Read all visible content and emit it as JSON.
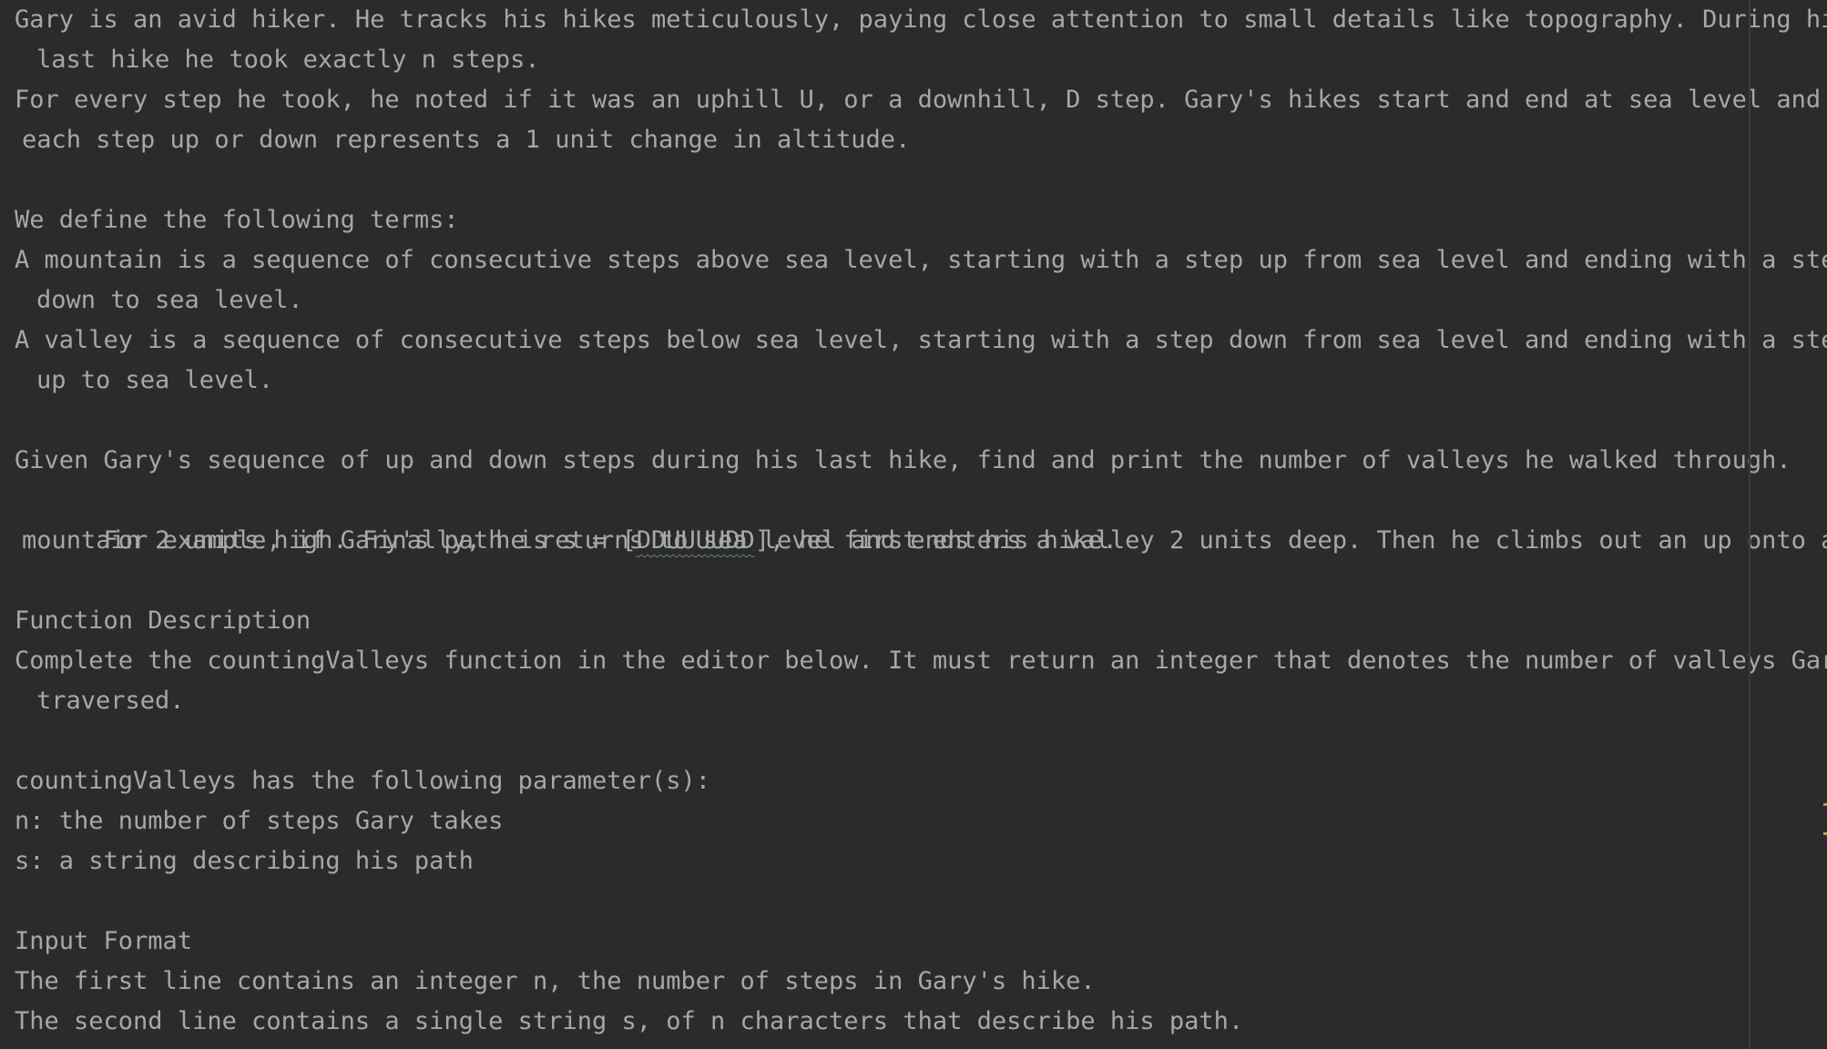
{
  "doc": {
    "lines": [
      "Gary is an avid hiker. He tracks his hikes meticulously, paying close attention to small details like topography. During his",
      "last hike he took exactly n steps.",
      "For every step he took, he noted if it was an uphill U, or a downhill, D step. Gary's hikes start and end at sea level and",
      "each step up or down represents a 1 unit change in altitude.",
      "",
      "We define the following terms:",
      "A mountain is a sequence of consecutive steps above sea level, starting with a step up from sea level and ending with a step",
      "down to sea level.",
      "A valley is a sequence of consecutive steps below sea level, starting with a step down from sea level and ending with a step",
      "up to sea level.",
      "",
      "Given Gary's sequence of up and down steps during his last hike, find and print the number of valleys he walked through.",
      "For example, if Gary's path is s = [",
      "DDUUUUDD",
      "], he first enters a valley 2 units deep. Then he climbs out an up onto a",
      "mountain 2 units high. Finally, he returns to sea level and ends his hike.",
      "",
      "Function Description",
      "Complete the countingValleys function in the editor below. It must return an integer that denotes the number of valleys Gary",
      "traversed.",
      "",
      "countingValleys has the following parameter(s):",
      "n: the number of steps Gary takes",
      "s: a string describing his path",
      "",
      "Input Format",
      "The first line contains an integer n, the number of steps in Gary's hike.",
      "The second line contains a single string s, of n characters that describe his path."
    ]
  },
  "colors": {
    "background": "#2b2b2b",
    "text": "#a7a7a7",
    "guide": "#3b3b3b",
    "marker": "#c7a13a"
  }
}
